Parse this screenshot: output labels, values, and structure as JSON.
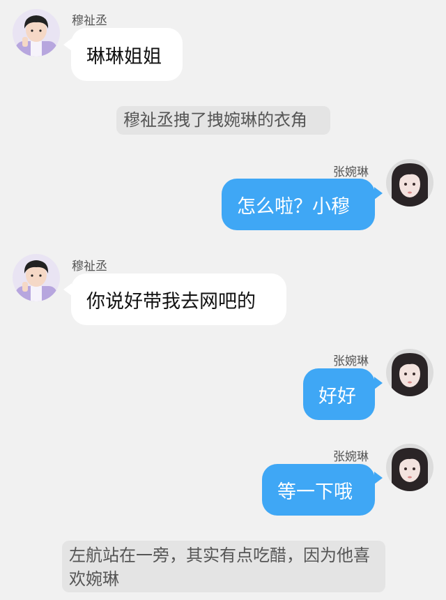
{
  "chat": {
    "characters": {
      "mu": {
        "name": "穆祉丞",
        "avatar_icon": "boy-avatar-icon"
      },
      "zhang": {
        "name": "张婉琳",
        "avatar_icon": "girl-avatar-icon"
      }
    },
    "messages": [
      {
        "sender": "穆祉丞",
        "text": "琳琳姐姐"
      },
      {
        "narration": "穆祉丞拽了拽婉琳的衣角"
      },
      {
        "sender": "张婉琳",
        "text": "怎么啦？小穆"
      },
      {
        "sender": "穆祉丞",
        "text": "你说好带我去网吧的"
      },
      {
        "sender": "张婉琳",
        "text": "好好"
      },
      {
        "sender": "张婉琳",
        "text": "等一下哦"
      },
      {
        "narration": "左航站在一旁，其实有点吃醋，因为他喜欢婉琳"
      }
    ]
  },
  "colors": {
    "background": "#f1f1f1",
    "left_bubble": "#ffffff",
    "right_bubble": "#3fa7f5",
    "narration_bg": "#e4e4e4"
  }
}
